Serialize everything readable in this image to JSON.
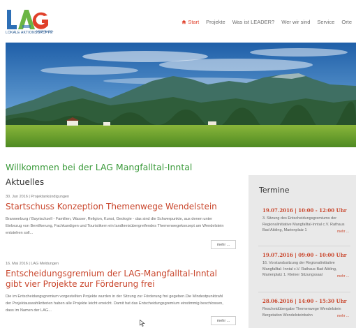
{
  "header": {
    "logo_caption": "LOKALE AKTIONSGRUPPE",
    "nav": [
      {
        "label": "Start",
        "active": true
      },
      {
        "label": "Projekte"
      },
      {
        "label": "Was ist LEADER?"
      },
      {
        "label": "Wer wir sind"
      },
      {
        "label": "Service"
      },
      {
        "label": "Orte"
      }
    ]
  },
  "welcome": "Willkommen bei der LAG Mangfalltal-Inntal",
  "news_section": {
    "title": "Aktuelles",
    "items": [
      {
        "meta": "30. Jun 2016 | Projektankündigungen",
        "title": "Startschuss Konzeption Themenwege Wendelstein",
        "text": "Brannenburg / Bayrischzell - Familien, Wasser, Religion, Kunst, Geologie - das sind die Schwerpunkte, aus denen unter Einbezug von Bevölkerung, Fachkundigen und Touristikern ein landkreisübergreifendes Themenwegekonzept am Wendelstein entstehen soll...",
        "more": "mehr ..."
      },
      {
        "meta": "16. Mai 2016 | LAG Meldungen",
        "title": "Entscheidungsgremium der LAG-Mangfalltal-Inntal gibt vier Projekte zur Förderung frei",
        "text": "Die im Entscheidungsgremium vorgestellten Projekte wurden in der Sitzung zur Förderung frei gegeben.Die Mindestpunktzahl der Projektauswahlkriterien haben alle Projekte leicht erreicht. Damit hat das Entscheidungsgremium einstimmig beschlossen, dass im Namen der LAG...",
        "more": "mehr ..."
      }
    ]
  },
  "sidebar": {
    "title": "Termine",
    "items": [
      {
        "date": "19.07.2016 | 10:00 - 12:00 Uhr",
        "text": "3. Sitzung des Entscheidungsgremiums der Regionalinitiative Mangfalltal-Inntal c.V. Rathaus Bad Aibling, Marienplatz 1",
        "more": "mehr ..."
      },
      {
        "date": "19.07.2016 | 09:00 - 10:00 Uhr",
        "text": "16. Vorstandssitzung der Regionalinitiative Mangfalltal- Inntal c.V. Rathaus Bad Aibling, Marienplatz 1. Kleiner Sitzungssaal",
        "more": "mehr ..."
      },
      {
        "date": "28.06.2016 | 14:00 - 15:30 Uhr",
        "text": "Rescheidübergabe Themenwege Wendelstein Bergstation Wendelsteinbahn",
        "more": "mehr ..."
      }
    ]
  },
  "colors": {
    "accent": "#c9462c",
    "green": "#3a9a3a",
    "sidebar_bg": "#e9e9e9"
  }
}
